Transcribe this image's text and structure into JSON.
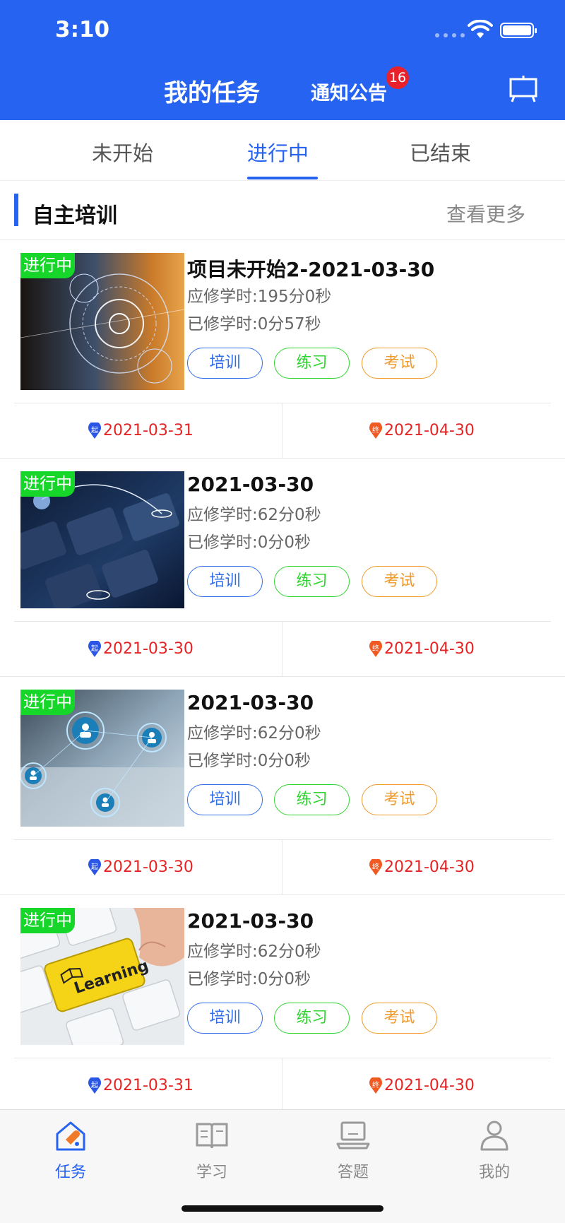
{
  "status_bar": {
    "time": "3:10"
  },
  "header": {
    "title": "我的任务",
    "notice_label": "通知公告",
    "notice_badge": "16"
  },
  "tabs": [
    {
      "label": "未开始"
    },
    {
      "label": "进行中"
    },
    {
      "label": "已结束"
    }
  ],
  "active_tab": "进行中",
  "section": {
    "title": "自主培训",
    "more": "查看更多"
  },
  "cards": [
    {
      "status": "进行中",
      "title": "项目未开始2-2021-03-30",
      "required": "应修学时:195分0秒",
      "done": "已修学时:0分57秒",
      "btn_train": "培训",
      "btn_practice": "练习",
      "btn_exam": "考试",
      "start": "2021-03-31",
      "end": "2021-04-30",
      "start_pin": "起",
      "end_pin": "终"
    },
    {
      "status": "进行中",
      "title": "2021-03-30",
      "required": "应修学时:62分0秒",
      "done": "已修学时:0分0秒",
      "btn_train": "培训",
      "btn_practice": "练习",
      "btn_exam": "考试",
      "start": "2021-03-30",
      "end": "2021-04-30",
      "start_pin": "起",
      "end_pin": "终"
    },
    {
      "status": "进行中",
      "title": "2021-03-30",
      "required": "应修学时:62分0秒",
      "done": "已修学时:0分0秒",
      "btn_train": "培训",
      "btn_practice": "练习",
      "btn_exam": "考试",
      "start": "2021-03-30",
      "end": "2021-04-30",
      "start_pin": "起",
      "end_pin": "终"
    },
    {
      "status": "进行中",
      "title": "2021-03-30",
      "required": "应修学时:62分0秒",
      "done": "已修学时:0分0秒",
      "btn_train": "培训",
      "btn_practice": "练习",
      "btn_exam": "考试",
      "start": "2021-03-31",
      "end": "2021-04-30",
      "start_pin": "起",
      "end_pin": "终",
      "thumb_word": "Learning"
    }
  ],
  "bottom_nav": [
    {
      "label": "任务",
      "icon": "task-icon"
    },
    {
      "label": "学习",
      "icon": "book-icon"
    },
    {
      "label": "答题",
      "icon": "laptop-icon"
    },
    {
      "label": "我的",
      "icon": "user-icon"
    }
  ],
  "colors": {
    "primary": "#2663f1",
    "status_green": "#16d62a",
    "date_red": "#e42424",
    "train_blue": "#2f6ee8",
    "practice_green": "#2fd52f",
    "exam_orange": "#f09a2a",
    "badge_red": "#e8212a"
  }
}
